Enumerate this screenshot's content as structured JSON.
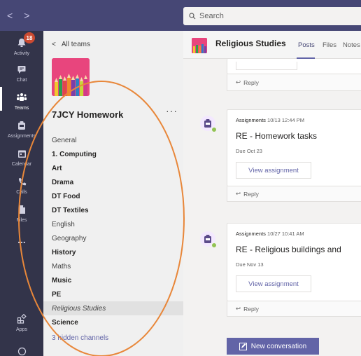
{
  "topbar": {
    "search_placeholder": "Search",
    "back_glyph": "<",
    "forward_glyph": ">"
  },
  "rail": {
    "items": [
      {
        "label": "Activity",
        "icon": "bell-icon",
        "badge": "18"
      },
      {
        "label": "Chat",
        "icon": "chat-icon"
      },
      {
        "label": "Teams",
        "icon": "teams-icon"
      },
      {
        "label": "Assignments",
        "icon": "assignments-icon"
      },
      {
        "label": "Calendar",
        "icon": "calendar-icon"
      },
      {
        "label": "Calls",
        "icon": "phone-icon"
      },
      {
        "label": "Files",
        "icon": "file-icon"
      },
      {
        "label": "...",
        "icon": "more-icon"
      },
      {
        "label": "Apps",
        "icon": "apps-icon"
      }
    ]
  },
  "sidebar": {
    "all_teams": "All teams",
    "team_name": "7JCY Homework",
    "more": "···",
    "channels": [
      {
        "label": "General",
        "style": "normal"
      },
      {
        "label": "1. Computing",
        "style": "bold"
      },
      {
        "label": "Art",
        "style": "bold"
      },
      {
        "label": "Drama",
        "style": "bold"
      },
      {
        "label": "DT Food",
        "style": "bold"
      },
      {
        "label": "DT Textiles",
        "style": "bold"
      },
      {
        "label": "English",
        "style": "normal"
      },
      {
        "label": "Geography",
        "style": "normal"
      },
      {
        "label": "History",
        "style": "bold"
      },
      {
        "label": "Maths",
        "style": "normal"
      },
      {
        "label": "Music",
        "style": "bold"
      },
      {
        "label": "PE",
        "style": "bold"
      },
      {
        "label": "Religious Studies",
        "style": "selected"
      },
      {
        "label": "Science",
        "style": "bold"
      },
      {
        "label": "3 hidden channels",
        "style": "link"
      }
    ]
  },
  "main": {
    "channel_title": "Religious Studies",
    "tabs": [
      "Posts",
      "Files",
      "Notes"
    ],
    "reply_label": "Reply",
    "posts": [
      {
        "sender": "Assignments",
        "time": "10/13 12:44 PM",
        "title": "RE - Homework tasks",
        "due": "Due Oct 23",
        "button": "View assignment"
      },
      {
        "sender": "Assignments",
        "time": "10/27 10:41 AM",
        "title": "RE - Religious buildings and",
        "due": "Due Nov 13",
        "button": "View assignment"
      }
    ],
    "new_conversation": "New conversation"
  },
  "colors": {
    "topbar": "#464775",
    "rail": "#33344a",
    "accent": "#6264a7",
    "badge": "#cc4a31",
    "annotation": "#e8873a"
  }
}
